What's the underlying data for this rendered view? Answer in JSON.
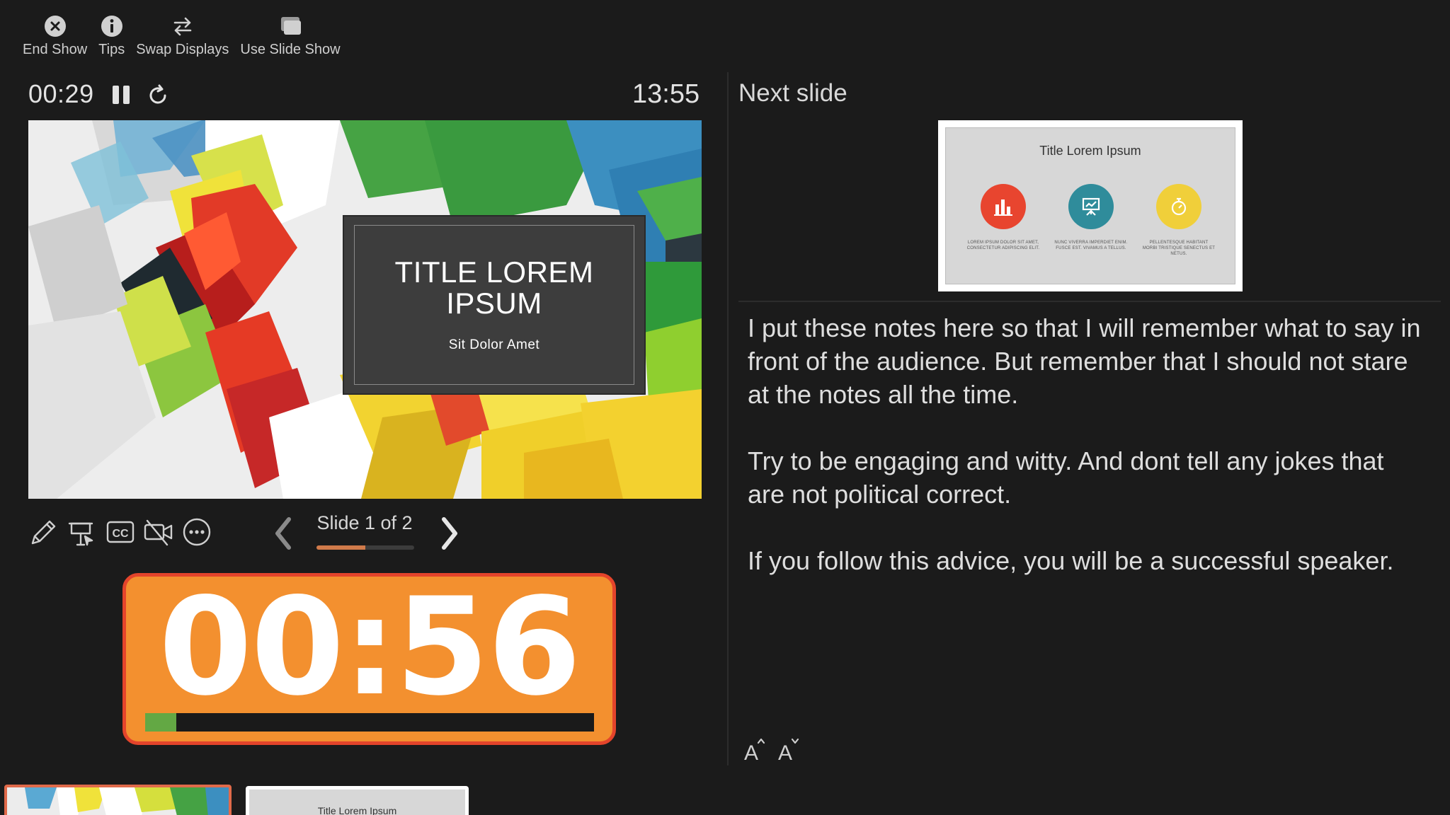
{
  "toolbar": {
    "end_show": "End Show",
    "tips": "Tips",
    "swap_displays": "Swap Displays",
    "use_slide_show": "Use Slide Show"
  },
  "presenter": {
    "elapsed": "00:29",
    "clock": "13:55",
    "next_slide_label": "Next slide"
  },
  "current_slide": {
    "title": "TITLE LOREM IPSUM",
    "subtitle": "Sit Dolor Amet"
  },
  "navigation": {
    "counter": "Slide 1 of 2",
    "progress": 0.5
  },
  "countdown": {
    "time": "00:56",
    "progress": 0.07,
    "colors": {
      "background": "#f3902f",
      "border": "#e4442b",
      "fill": "#63a844"
    }
  },
  "next_slide": {
    "title": "Title Lorem Ipsum",
    "captions": [
      "LOREM IPSUM DOLOR SIT AMET, CONSECTETUR ADIPISCING ELIT.",
      "NUNC VIVERRA IMPERDIET ENIM. FUSCE EST. VIVAMUS A TELLUS.",
      "PELLENTESQUE HABITANT MORBI TRISTIQUE SENECTUS ET NETUS."
    ],
    "circle_colors": [
      "#e8452f",
      "#2f8c9b",
      "#f0cf3a"
    ]
  },
  "notes": {
    "paragraphs": [
      "I put these notes here so that I will remember what to say in front of the audience. But remember that I should not stare at the notes all the time.",
      "Try to be engaging and witty. And dont tell any jokes that are not political correct.",
      "If you follow this advice, you will be a successful speaker."
    ]
  },
  "thumbnails": [
    {
      "title": ""
    },
    {
      "title": "Title Lorem Ipsum"
    }
  ]
}
